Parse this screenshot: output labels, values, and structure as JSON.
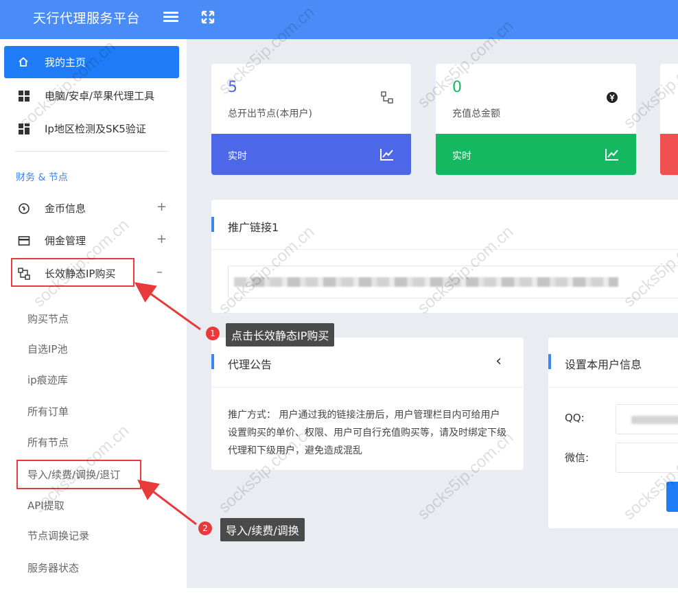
{
  "header": {
    "brand": "天行代理服务平台"
  },
  "sidebar": {
    "home": "我的主页",
    "tools": "电脑/安卓/苹果代理工具",
    "ipcheck": "Ip地区检测及SK5验证",
    "section": "财务 & 节点",
    "menus": [
      {
        "label": "金币信息",
        "toggle": "+"
      },
      {
        "label": "佣金管理",
        "toggle": "+"
      },
      {
        "label": "长效静态IP购买",
        "toggle": "–"
      }
    ],
    "subs": [
      "购买节点",
      "自选IP池",
      "ip痕迹库",
      "所有订单",
      "所有节点",
      "导入/续费/调换/退订",
      "API提取",
      "节点调换记录",
      "服务器状态"
    ]
  },
  "stats": [
    {
      "value": "5",
      "label": "总开出节点(本用户)",
      "footer": "实时",
      "color": "#4c67e8",
      "num_color": "#4c67e8"
    },
    {
      "value": "0",
      "label": "充值总金额",
      "footer": "实时",
      "color": "#14b861",
      "num_color": "#14b861"
    }
  ],
  "promo": {
    "title": "推广链接1"
  },
  "notice": {
    "title": "代理公告",
    "collapse": "‹",
    "text": "推广方式： 用户通过我的链接注册后，用户管理栏目内可给用户设置购买的单价、权限、用户可自行充值购买等，请及时绑定下级代理和下级用户，避免造成混乱"
  },
  "userinfo": {
    "title": "设置本用户信息",
    "qq_label": "QQ:",
    "wechat_label": "微信:"
  },
  "callouts": [
    {
      "num": "1",
      "text": "点击长效静态IP购买"
    },
    {
      "num": "2",
      "text": "导入/续费/调换"
    }
  ],
  "watermark": "socks5ip.com.cn",
  "colors": {
    "topbar": "#4a8cf7",
    "accent": "#1f7cf6",
    "red": "#e83a3a"
  }
}
